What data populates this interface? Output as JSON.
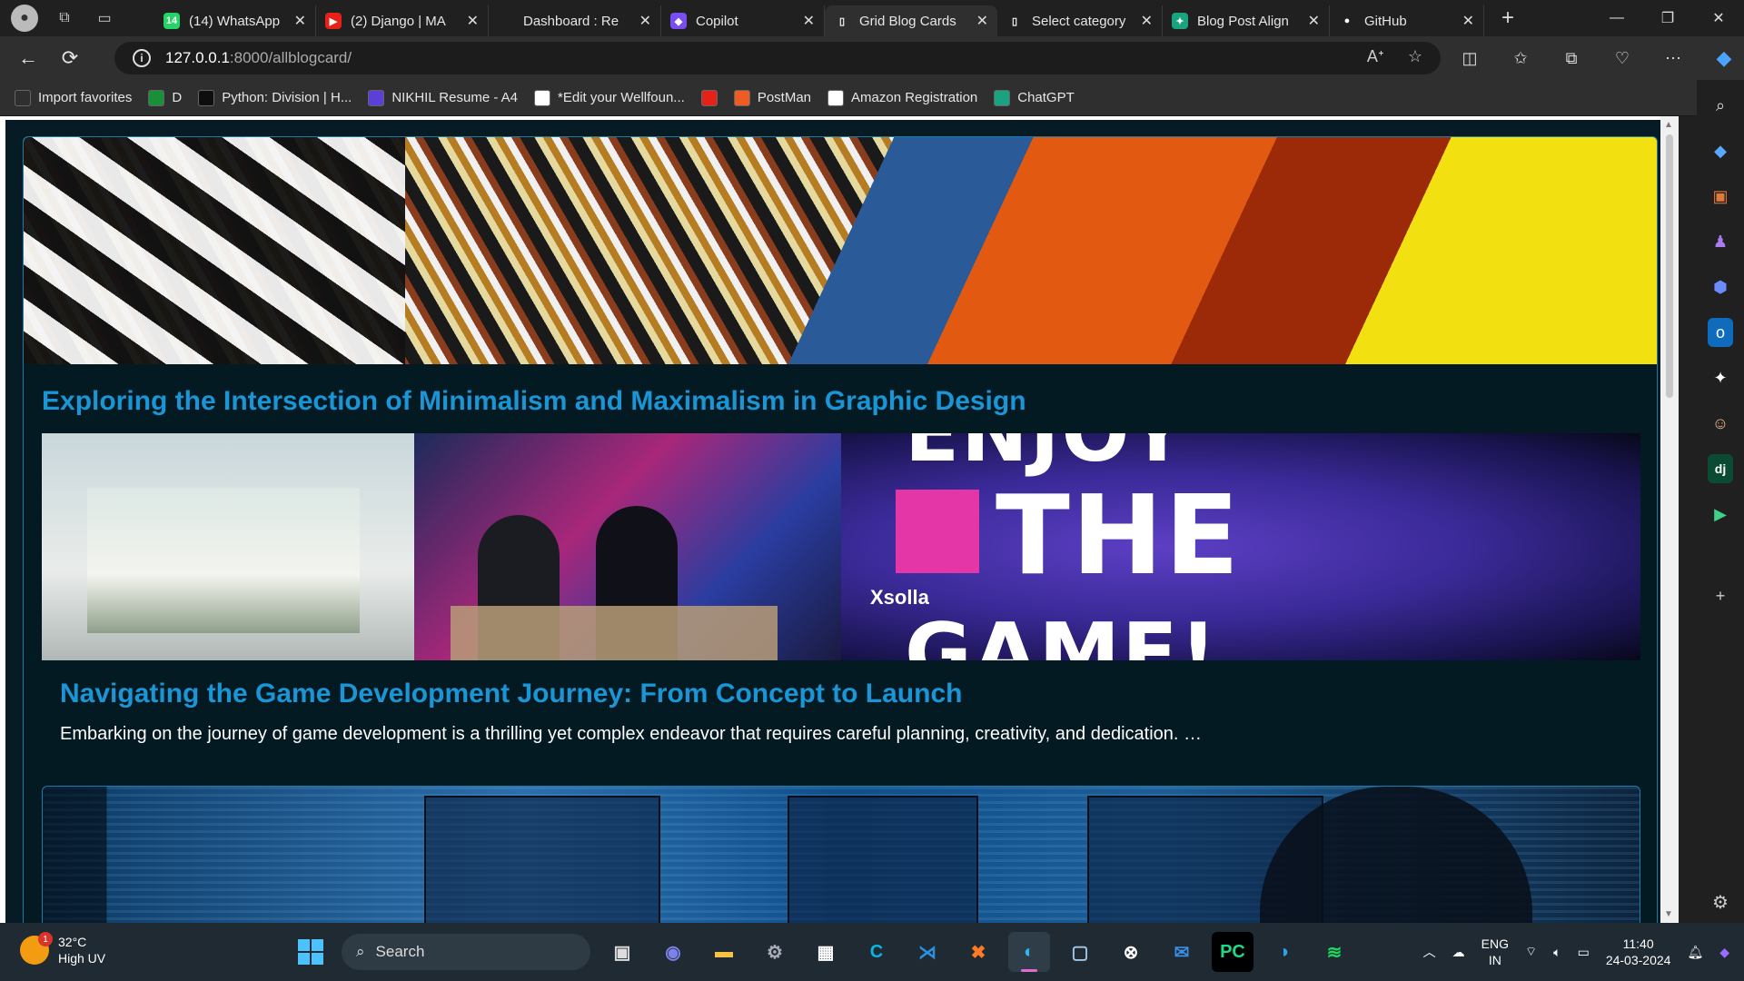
{
  "tabs": [
    {
      "label": "(14) WhatsApp",
      "icon": "whatsapp-icon",
      "color": "#25d366",
      "glyph": "14"
    },
    {
      "label": "(2) Django | MA",
      "icon": "youtube-icon",
      "color": "#e62117",
      "glyph": "▶"
    },
    {
      "label": "Dashboard : Re",
      "icon": "dashboard-icon",
      "color": "#202020",
      "glyph": ""
    },
    {
      "label": "Copilot",
      "icon": "copilot-icon",
      "color": "#7a4df0",
      "glyph": "◆"
    },
    {
      "label": "Grid Blog Cards",
      "icon": "page-icon",
      "color": "#2f2f2f",
      "glyph": "▯",
      "active": true
    },
    {
      "label": "Select category",
      "icon": "page-icon",
      "color": "#202020",
      "glyph": "▯"
    },
    {
      "label": "Blog Post Align",
      "icon": "chatgpt-icon",
      "color": "#19a37f",
      "glyph": "✦"
    },
    {
      "label": "GitHub",
      "icon": "github-icon",
      "color": "#202020",
      "glyph": "●"
    }
  ],
  "address": {
    "host": "127.0.0.1",
    "path": ":8000/allblogcard/"
  },
  "favorites": [
    {
      "label": "Import favorites",
      "icon": "import-icon",
      "color": "#2f2f2f"
    },
    {
      "label": "D",
      "icon": "django-icon",
      "color": "#1a8f3a"
    },
    {
      "label": "Python: Division | H...",
      "icon": "hackerrank-icon",
      "color": "#0e0e0e"
    },
    {
      "label": "NIKHIL Resume - A4",
      "icon": "resume-icon",
      "color": "#5b3fd6"
    },
    {
      "label": "*Edit your Wellfoun...",
      "icon": "wellfound-icon",
      "color": "#ffffff"
    },
    {
      "label": "",
      "icon": "youtube-icon",
      "color": "#e62117"
    },
    {
      "label": "PostMan",
      "icon": "postman-icon",
      "color": "#ef5b25"
    },
    {
      "label": "Amazon Registration",
      "icon": "amazon-icon",
      "color": "#ffffff"
    },
    {
      "label": "ChatGPT",
      "icon": "chatgpt-icon",
      "color": "#19a37f"
    }
  ],
  "blog": {
    "featured_title": "Exploring the Intersection of Minimalism and Maximalism in Graphic Design",
    "post_title": "Navigating the Game Development Journey: From Concept to Launch",
    "post_excerpt": "Embarking on the journey of game development is a thrilling yet complex endeavor that requires careful planning, creativity, and dedication. …",
    "banner_line1": "ENJOY",
    "banner_line2": "THE",
    "banner_line3": "GAME!",
    "banner_brand": "Xsolla"
  },
  "taskbar": {
    "weather_temp": "32°C",
    "weather_desc": "High UV",
    "weather_badge": "1",
    "search_placeholder": "Search",
    "lang_top": "ENG",
    "lang_bottom": "IN",
    "time": "11:40",
    "date": "24-03-2024"
  },
  "colors": {
    "title_blue": "#1a96d6",
    "page_bg": "#061b24",
    "card_border": "#1b7ba8"
  }
}
